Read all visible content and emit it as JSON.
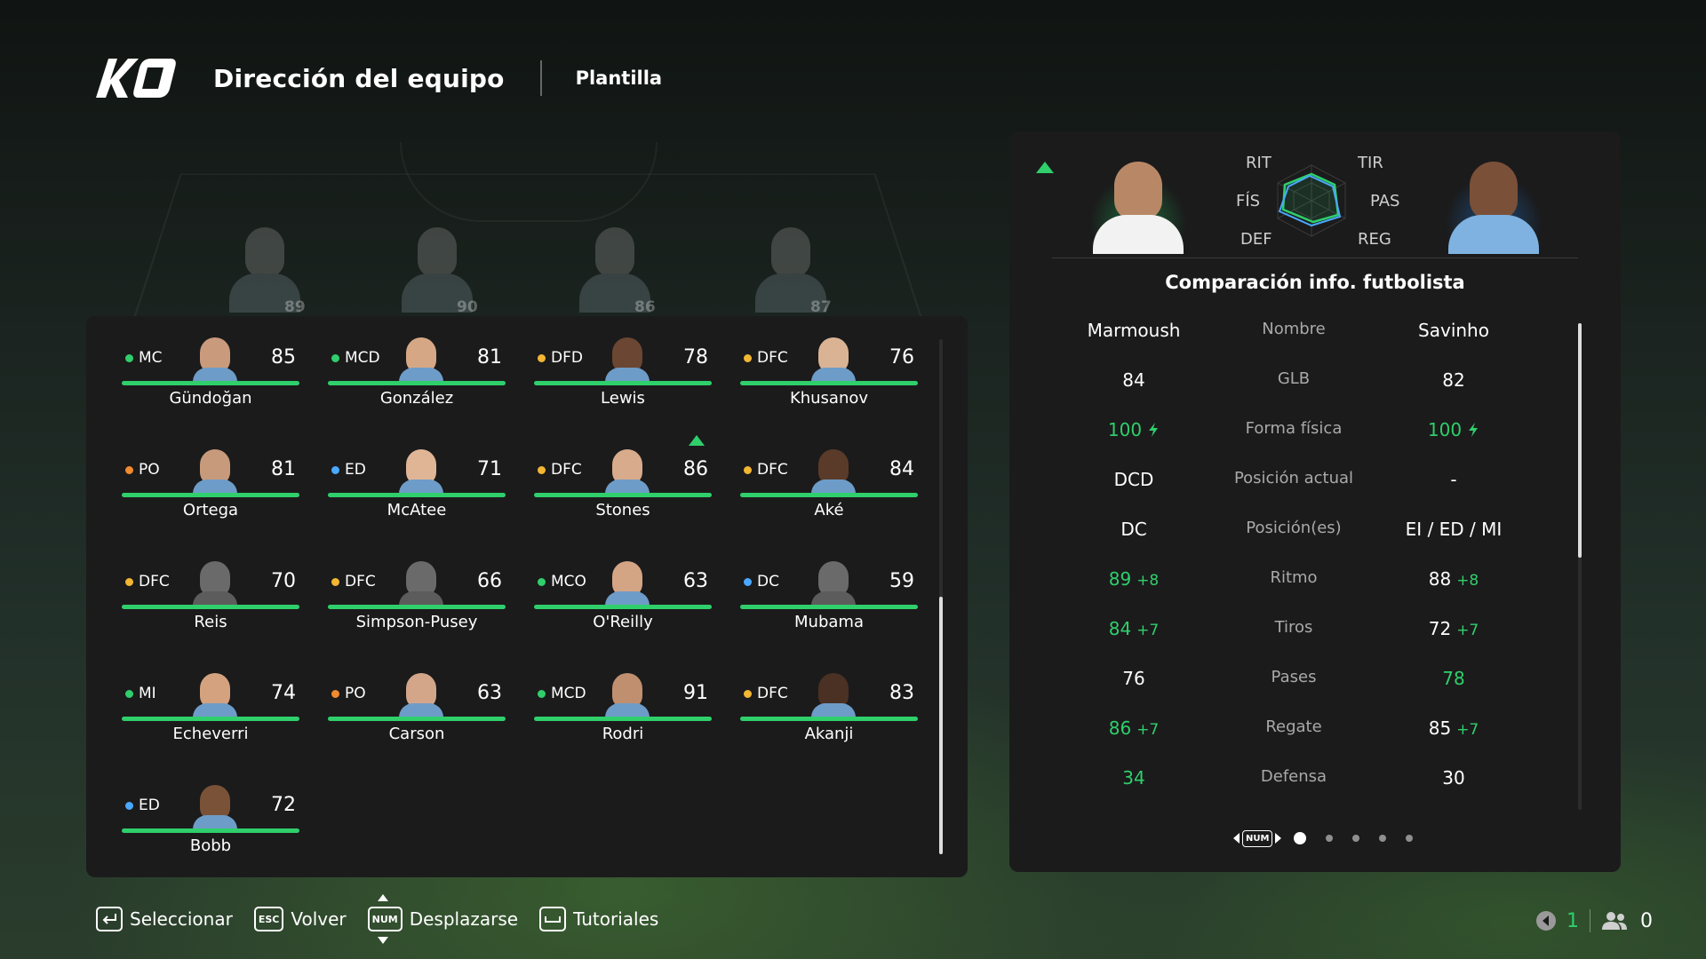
{
  "header": {
    "logo_text": "KO",
    "title": "Dirección del equipo",
    "tab": "Plantilla"
  },
  "background_players": [
    {
      "rating": "89"
    },
    {
      "rating": "90"
    },
    {
      "rating": "86"
    },
    {
      "rating": "87"
    }
  ],
  "colors": {
    "accent_green": "#2fcf6b",
    "pos_mid": "#2fcf6b",
    "pos_def": "#f2b632",
    "pos_gk": "#f28a2e",
    "pos_att": "#4aa8ff"
  },
  "squad": [
    {
      "pos": "MC",
      "pos_color": "#2fcf6b",
      "rating": "85",
      "name": "Gündoğan",
      "skin": "#c99a7c",
      "silhouette": false,
      "arrow": false
    },
    {
      "pos": "MCD",
      "pos_color": "#2fcf6b",
      "rating": "81",
      "name": "González",
      "skin": "#d6a784",
      "silhouette": false,
      "arrow": false
    },
    {
      "pos": "DFD",
      "pos_color": "#f2b632",
      "rating": "78",
      "name": "Lewis",
      "skin": "#6a4633",
      "silhouette": false,
      "arrow": false
    },
    {
      "pos": "DFC",
      "pos_color": "#f2b632",
      "rating": "76",
      "name": "Khusanov",
      "skin": "#d9b394",
      "silhouette": false,
      "arrow": false
    },
    {
      "pos": "PO",
      "pos_color": "#f28a2e",
      "rating": "81",
      "name": "Ortega",
      "skin": "#c79a7b",
      "silhouette": false,
      "arrow": false
    },
    {
      "pos": "ED",
      "pos_color": "#4aa8ff",
      "rating": "71",
      "name": "McAtee",
      "skin": "#e0b596",
      "silhouette": false,
      "arrow": false
    },
    {
      "pos": "DFC",
      "pos_color": "#f2b632",
      "rating": "86",
      "name": "Stones",
      "skin": "#d7ab8c",
      "silhouette": false,
      "arrow": true
    },
    {
      "pos": "DFC",
      "pos_color": "#f2b632",
      "rating": "84",
      "name": "Aké",
      "skin": "#5a3b2a",
      "silhouette": false,
      "arrow": false
    },
    {
      "pos": "DFC",
      "pos_color": "#f2b632",
      "rating": "70",
      "name": "Reis",
      "skin": "#6a6a6a",
      "silhouette": true,
      "arrow": false
    },
    {
      "pos": "DFC",
      "pos_color": "#f2b632",
      "rating": "66",
      "name": "Simpson-Pusey",
      "skin": "#6a6a6a",
      "silhouette": true,
      "arrow": false
    },
    {
      "pos": "MCO",
      "pos_color": "#2fcf6b",
      "rating": "63",
      "name": "O'Reilly",
      "skin": "#d4a585",
      "silhouette": false,
      "arrow": false
    },
    {
      "pos": "DC",
      "pos_color": "#4aa8ff",
      "rating": "59",
      "name": "Mubama",
      "skin": "#6a6a6a",
      "silhouette": true,
      "arrow": false
    },
    {
      "pos": "MI",
      "pos_color": "#2fcf6b",
      "rating": "74",
      "name": "Echeverri",
      "skin": "#d4a27f",
      "silhouette": false,
      "arrow": false
    },
    {
      "pos": "PO",
      "pos_color": "#f28a2e",
      "rating": "63",
      "name": "Carson",
      "skin": "#d3a68a",
      "silhouette": false,
      "arrow": false
    },
    {
      "pos": "MCD",
      "pos_color": "#2fcf6b",
      "rating": "91",
      "name": "Rodri",
      "skin": "#c08f70",
      "silhouette": false,
      "arrow": false
    },
    {
      "pos": "DFC",
      "pos_color": "#f2b632",
      "rating": "83",
      "name": "Akanji",
      "skin": "#4a3124",
      "silhouette": false,
      "arrow": false
    },
    {
      "pos": "ED",
      "pos_color": "#4aa8ff",
      "rating": "72",
      "name": "Bobb",
      "skin": "#7a5238",
      "silhouette": false,
      "arrow": false
    }
  ],
  "comparison": {
    "title": "Comparación info. futbolista",
    "radar_labels": {
      "rit": "RIT",
      "tir": "TIR",
      "fis": "FÍS",
      "pas": "PAS",
      "def": "DEF",
      "reg": "REG"
    },
    "left_player": {
      "skin": "#b88866",
      "glow": "#1f6b3a",
      "kit": "#f2f2f2"
    },
    "right_player": {
      "skin": "#7a5038",
      "glow": "#1f4c7a",
      "kit": "#7fb2e0"
    },
    "rows": [
      {
        "label": "Nombre",
        "left": "Marmoush",
        "left_green": false,
        "left_bonus": "",
        "left_bolt": false,
        "right": "Savinho",
        "right_green": false,
        "right_bonus": "",
        "right_bolt": false
      },
      {
        "label": "GLB",
        "left": "84",
        "left_green": false,
        "left_bonus": "",
        "left_bolt": false,
        "right": "82",
        "right_green": false,
        "right_bonus": "",
        "right_bolt": false
      },
      {
        "label": "Forma física",
        "left": "100",
        "left_green": true,
        "left_bonus": "",
        "left_bolt": true,
        "right": "100",
        "right_green": true,
        "right_bonus": "",
        "right_bolt": true
      },
      {
        "label": "Posición actual",
        "left": "DCD",
        "left_green": false,
        "left_bonus": "",
        "left_bolt": false,
        "right": "-",
        "right_green": false,
        "right_bonus": "",
        "right_bolt": false
      },
      {
        "label": "Posición(es)",
        "left": "DC",
        "left_green": false,
        "left_bonus": "",
        "left_bolt": false,
        "right": "EI / ED / MI",
        "right_green": false,
        "right_bonus": "",
        "right_bolt": false
      },
      {
        "label": "Ritmo",
        "left": "89",
        "left_green": true,
        "left_bonus": "+8",
        "left_bolt": false,
        "right": "88",
        "right_green": false,
        "right_bonus": "+8",
        "right_bolt": false
      },
      {
        "label": "Tiros",
        "left": "84",
        "left_green": true,
        "left_bonus": "+7",
        "left_bolt": false,
        "right": "72",
        "right_green": false,
        "right_bonus": "+7",
        "right_bolt": false
      },
      {
        "label": "Pases",
        "left": "76",
        "left_green": false,
        "left_bonus": "",
        "left_bolt": false,
        "right": "78",
        "right_green": true,
        "right_bonus": "",
        "right_bolt": false
      },
      {
        "label": "Regate",
        "left": "86",
        "left_green": true,
        "left_bonus": "+7",
        "left_bolt": false,
        "right": "85",
        "right_green": false,
        "right_bonus": "+7",
        "right_bolt": false
      },
      {
        "label": "Defensa",
        "left": "34",
        "left_green": true,
        "left_bonus": "",
        "left_bolt": false,
        "right": "30",
        "right_green": false,
        "right_bonus": "",
        "right_bolt": false
      }
    ],
    "pager": {
      "key": "NUM",
      "pages": 5,
      "active": 1
    }
  },
  "footer": {
    "select": {
      "key": "",
      "label": "Seleccionar"
    },
    "back": {
      "key": "ESC",
      "label": "Volver"
    },
    "scroll": {
      "key": "NUM",
      "label": "Desplazarse"
    },
    "tutorials": {
      "key": "",
      "label": "Tutoriales"
    }
  },
  "status": {
    "first_count": "1",
    "second_count": "0"
  }
}
